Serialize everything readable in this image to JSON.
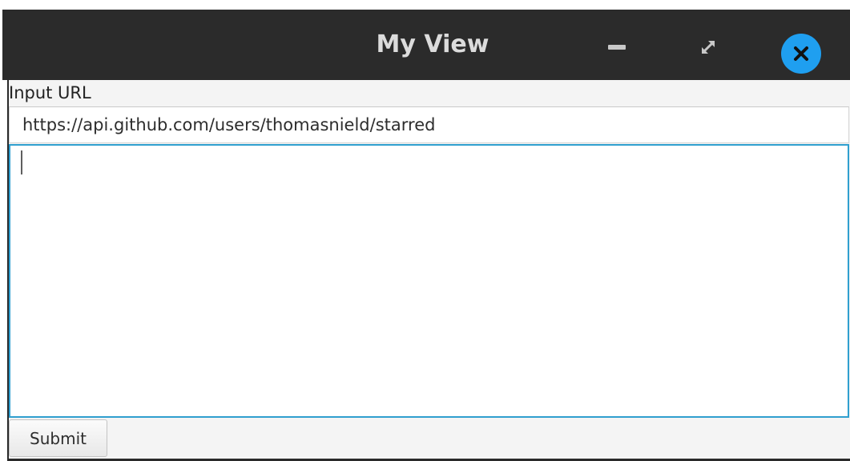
{
  "window": {
    "title": "My View",
    "minimize_icon": "minimize-icon",
    "maximize_icon": "maximize-icon",
    "close_icon": "close-icon",
    "close_color": "#1f9ff0"
  },
  "form": {
    "url_label": "Input URL",
    "url_value": "https://api.github.com/users/thomasnield/starred",
    "response_text": "",
    "submit_label": "Submit"
  },
  "colors": {
    "titlebar": "#2b2b2b",
    "focus_border": "#2f9fcf"
  }
}
